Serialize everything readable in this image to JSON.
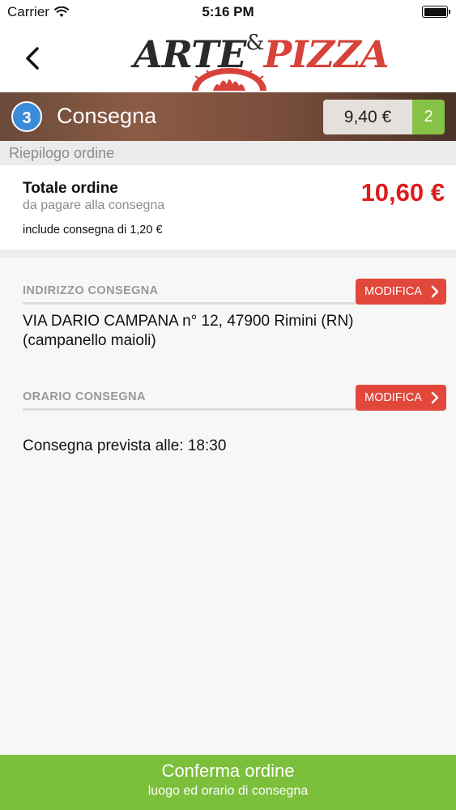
{
  "status_bar": {
    "carrier": "Carrier",
    "time": "5:16 PM"
  },
  "header": {
    "logo": {
      "arte": "ARTE",
      "amp": "&",
      "pizza": "PIZZA"
    }
  },
  "step": {
    "number": "3",
    "title": "Consegna"
  },
  "cart": {
    "total": "9,40 €",
    "count": "2"
  },
  "summary": {
    "section_label": "Riepilogo ordine",
    "total_label": "Totale ordine",
    "total_sub": "da pagare alla consegna",
    "total_amount": "10,60 €",
    "delivery_fee": "include consegna di 1,20 €"
  },
  "delivery_address": {
    "label": "INDIRIZZO CONSEGNA",
    "edit_label": "MODIFICA",
    "line1": "VIA DARIO CAMPANA n° 12, 47900 Rimini (RN)",
    "line2": "(campanello maioli)"
  },
  "delivery_time": {
    "label": "ORARIO CONSEGNA",
    "edit_label": "MODIFICA",
    "eta": "Consegna prevista alle: 18:30"
  },
  "confirm": {
    "title": "Conferma ordine",
    "subtitle": "luogo ed orario di consegna"
  },
  "colors": {
    "accent_red": "#e2473c",
    "price_red": "#e01b1b",
    "confirm_green": "#7cbf3b",
    "step_blue": "#3c8bd8",
    "cart_green": "#86c246"
  },
  "icons": [
    "wifi-icon",
    "battery-icon",
    "back-chevron-icon",
    "oven-icon",
    "chevron-right-icon"
  ]
}
